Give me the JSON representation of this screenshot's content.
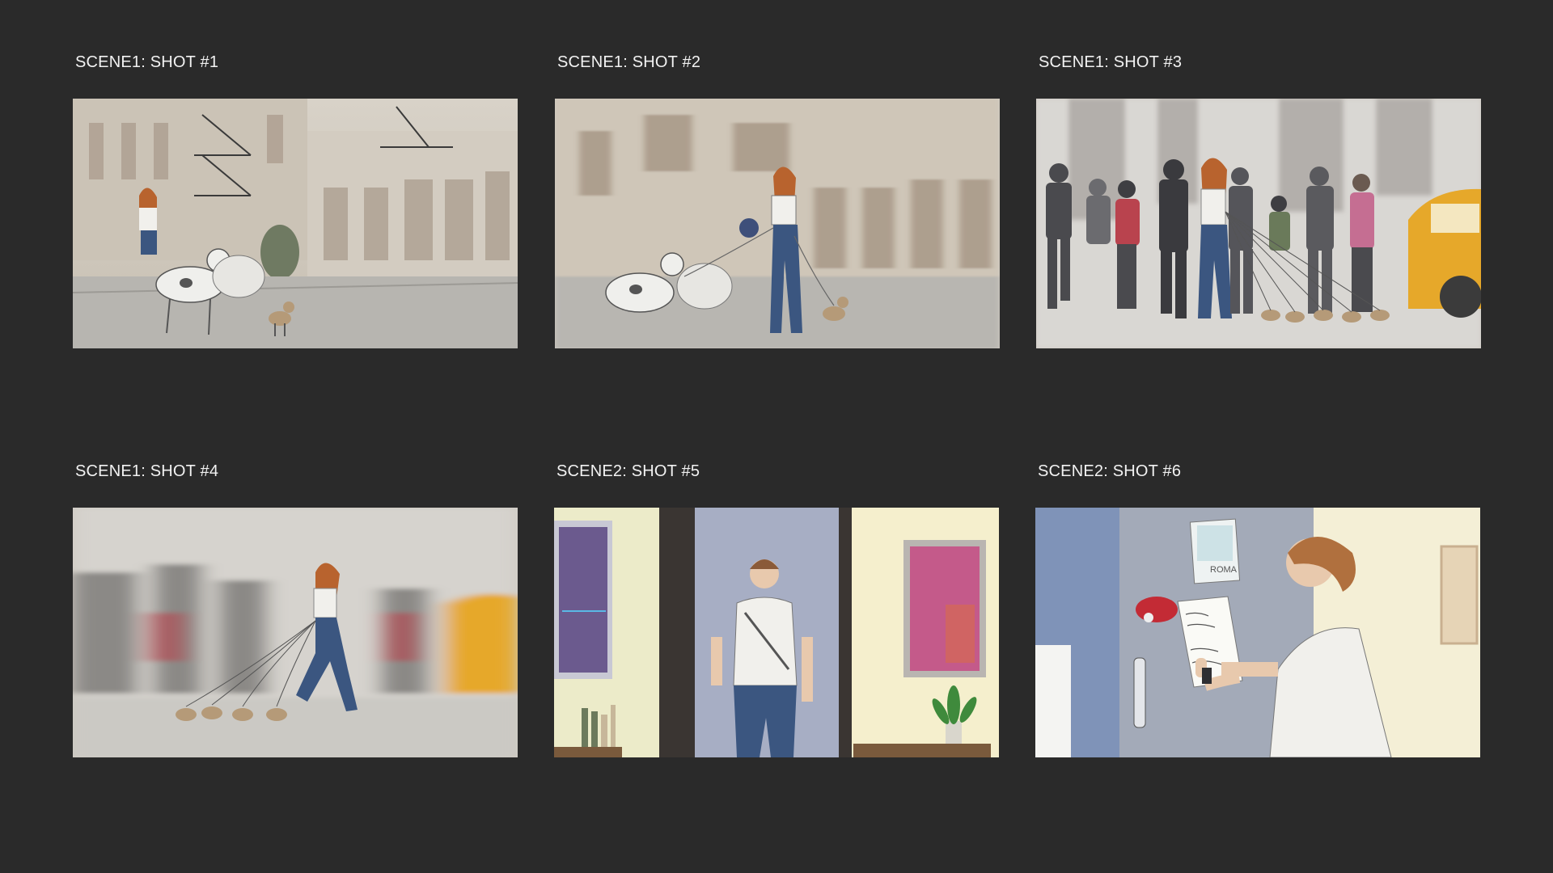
{
  "colors": {
    "background": "#2a2a2a",
    "label": "#f2f2f2",
    "taxi": "#e6a82a",
    "denim": "#3b5680",
    "hair": "#b8632e"
  },
  "shots": [
    {
      "label": "SCENE1: SHOT #1"
    },
    {
      "label": "SCENE1: SHOT #2"
    },
    {
      "label": "SCENE1: SHOT #3"
    },
    {
      "label": "SCENE1: SHOT #4"
    },
    {
      "label": "SCENE2: SHOT #5"
    },
    {
      "label": "SCENE2: SHOT #6",
      "note_sign": "ROMA"
    }
  ]
}
